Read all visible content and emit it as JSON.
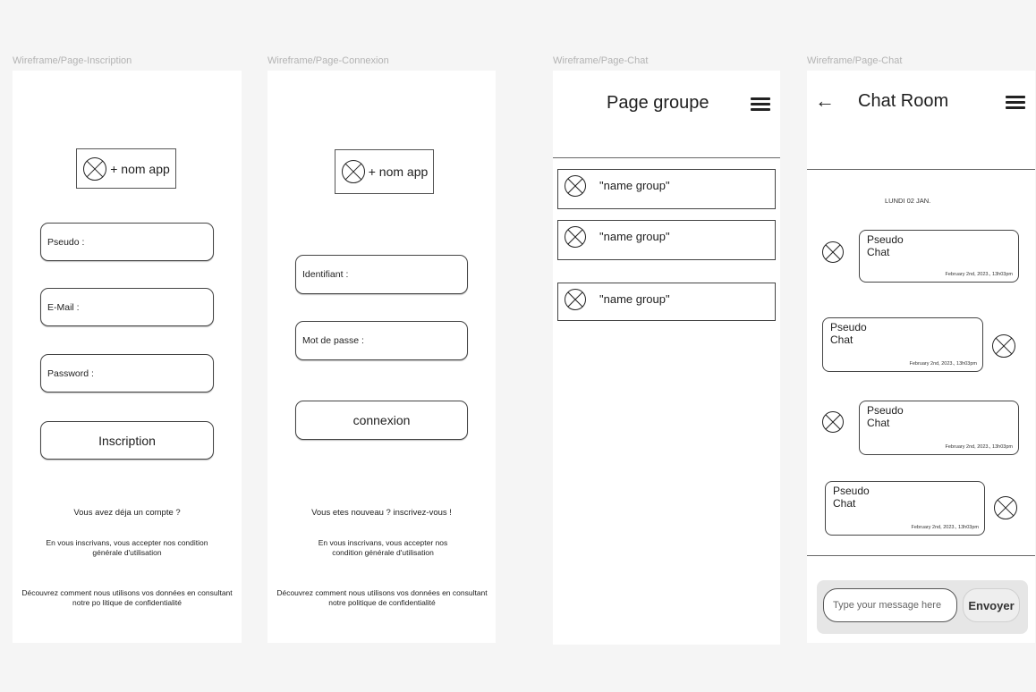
{
  "frames": {
    "inscription": {
      "label": "Wireframe/Page-Inscription",
      "logo_text": "+ nom app",
      "pseudo_placeholder": "Pseudo :",
      "email_placeholder": "E-Mail :",
      "password_placeholder": "Password :",
      "submit_label": "Inscription",
      "already_account": "Vous avez déja un compte ?",
      "terms": "En vous inscrivans, vous accepter nos condition générale d'utilisation",
      "privacy": "Découvrez comment nous utilisons vos données en consultant notre po litique de confidentialité"
    },
    "connexion": {
      "label": "Wireframe/Page-Connexion",
      "logo_text": "+ nom app",
      "identifiant_placeholder": "Identifiant :",
      "password_placeholder": "Mot de passe :",
      "submit_label": "connexion",
      "new_user": "Vous etes nouveau ? inscrivez-vous !",
      "terms": "En vous inscrivans, vous accepter nos condition générale d'utilisation",
      "privacy": "Découvrez comment nous utilisons vos données en consultant notre politique de confidentialité"
    },
    "groups": {
      "label": "Wireframe/Page-Chat",
      "title": "Page groupe",
      "menu_icon": "hamburger-icon",
      "items": [
        {
          "name": "\"name group\""
        },
        {
          "name": "\"name group\""
        },
        {
          "name": "\"name group\""
        }
      ]
    },
    "chatroom": {
      "label": "Wireframe/Page-Chat",
      "title": "Chat Room",
      "back_icon": "back-arrow-icon",
      "menu_icon": "hamburger-icon",
      "date_separator": "LUNDI 02 JAN.",
      "messages": [
        {
          "pseudo": "Pseudo",
          "text": "Chat",
          "time": "February 2nd, 2023., 13h03pm",
          "side": "left"
        },
        {
          "pseudo": "Pseudo",
          "text": "Chat",
          "time": "February 2nd, 2023., 13h03pm",
          "side": "right"
        },
        {
          "pseudo": "Pseudo",
          "text": "Chat",
          "time": "February 2nd, 2023., 13h03pm",
          "side": "left"
        },
        {
          "pseudo": "Pseudo",
          "text": "Chat",
          "time": "February 2nd, 2023., 13h03pm",
          "side": "right"
        }
      ],
      "input_placeholder": "Type your message here",
      "send_label": "Envoyer"
    }
  }
}
